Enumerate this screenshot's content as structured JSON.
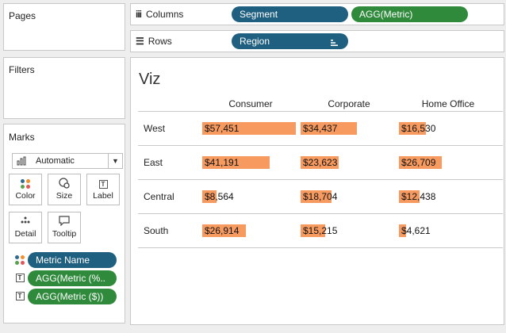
{
  "panels": {
    "pages_title": "Pages",
    "filters_title": "Filters",
    "marks_title": "Marks"
  },
  "marks": {
    "type_label": "Automatic",
    "buttons": [
      {
        "label": "Color",
        "icon": "color-dots-icon"
      },
      {
        "label": "Size",
        "icon": "size-icon"
      },
      {
        "label": "Label",
        "icon": "label-icon"
      },
      {
        "label": "Detail",
        "icon": "detail-icon"
      },
      {
        "label": "Tooltip",
        "icon": "tooltip-icon"
      }
    ],
    "fields": [
      {
        "icon": "color-dots-icon",
        "label": "Metric Name",
        "color": "#1f5f7f"
      },
      {
        "icon": "label-icon",
        "label": "AGG(Metric (%..",
        "color": "#2f8a3c"
      },
      {
        "icon": "label-icon",
        "label": "AGG(Metric ($))",
        "color": "#2f8a3c"
      }
    ]
  },
  "shelves": {
    "columns_label": "Columns",
    "columns_pills": [
      "Segment",
      "AGG(Metric)"
    ],
    "rows_label": "Rows",
    "rows_pills": [
      "Region"
    ]
  },
  "viz": {
    "title": "Viz",
    "columns": [
      "Consumer",
      "Corporate",
      "Home Office"
    ],
    "rows": [
      {
        "region": "West",
        "values": [
          "$57,451",
          "$34,437",
          "$16,530"
        ],
        "fractions": [
          1.0,
          0.6,
          0.29
        ]
      },
      {
        "region": "East",
        "values": [
          "$41,191",
          "$23,623",
          "$26,709"
        ],
        "fractions": [
          0.72,
          0.41,
          0.46
        ]
      },
      {
        "region": "Central",
        "values": [
          "$8,564",
          "$18,704",
          "$12,438"
        ],
        "fractions": [
          0.15,
          0.33,
          0.22
        ]
      },
      {
        "region": "South",
        "values": [
          "$26,914",
          "$15,215",
          "$4,621"
        ],
        "fractions": [
          0.47,
          0.26,
          0.08
        ]
      }
    ],
    "bar_color": "#f79a60"
  }
}
